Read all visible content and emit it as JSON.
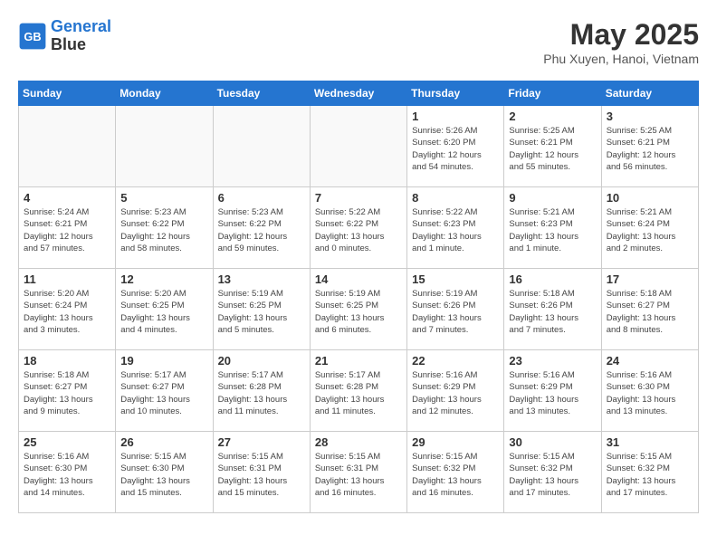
{
  "header": {
    "logo_line1": "General",
    "logo_line2": "Blue",
    "month": "May 2025",
    "location": "Phu Xuyen, Hanoi, Vietnam"
  },
  "weekdays": [
    "Sunday",
    "Monday",
    "Tuesday",
    "Wednesday",
    "Thursday",
    "Friday",
    "Saturday"
  ],
  "weeks": [
    [
      {
        "day": "",
        "info": ""
      },
      {
        "day": "",
        "info": ""
      },
      {
        "day": "",
        "info": ""
      },
      {
        "day": "",
        "info": ""
      },
      {
        "day": "1",
        "info": "Sunrise: 5:26 AM\nSunset: 6:20 PM\nDaylight: 12 hours\nand 54 minutes."
      },
      {
        "day": "2",
        "info": "Sunrise: 5:25 AM\nSunset: 6:21 PM\nDaylight: 12 hours\nand 55 minutes."
      },
      {
        "day": "3",
        "info": "Sunrise: 5:25 AM\nSunset: 6:21 PM\nDaylight: 12 hours\nand 56 minutes."
      }
    ],
    [
      {
        "day": "4",
        "info": "Sunrise: 5:24 AM\nSunset: 6:21 PM\nDaylight: 12 hours\nand 57 minutes."
      },
      {
        "day": "5",
        "info": "Sunrise: 5:23 AM\nSunset: 6:22 PM\nDaylight: 12 hours\nand 58 minutes."
      },
      {
        "day": "6",
        "info": "Sunrise: 5:23 AM\nSunset: 6:22 PM\nDaylight: 12 hours\nand 59 minutes."
      },
      {
        "day": "7",
        "info": "Sunrise: 5:22 AM\nSunset: 6:22 PM\nDaylight: 13 hours\nand 0 minutes."
      },
      {
        "day": "8",
        "info": "Sunrise: 5:22 AM\nSunset: 6:23 PM\nDaylight: 13 hours\nand 1 minute."
      },
      {
        "day": "9",
        "info": "Sunrise: 5:21 AM\nSunset: 6:23 PM\nDaylight: 13 hours\nand 1 minute."
      },
      {
        "day": "10",
        "info": "Sunrise: 5:21 AM\nSunset: 6:24 PM\nDaylight: 13 hours\nand 2 minutes."
      }
    ],
    [
      {
        "day": "11",
        "info": "Sunrise: 5:20 AM\nSunset: 6:24 PM\nDaylight: 13 hours\nand 3 minutes."
      },
      {
        "day": "12",
        "info": "Sunrise: 5:20 AM\nSunset: 6:25 PM\nDaylight: 13 hours\nand 4 minutes."
      },
      {
        "day": "13",
        "info": "Sunrise: 5:19 AM\nSunset: 6:25 PM\nDaylight: 13 hours\nand 5 minutes."
      },
      {
        "day": "14",
        "info": "Sunrise: 5:19 AM\nSunset: 6:25 PM\nDaylight: 13 hours\nand 6 minutes."
      },
      {
        "day": "15",
        "info": "Sunrise: 5:19 AM\nSunset: 6:26 PM\nDaylight: 13 hours\nand 7 minutes."
      },
      {
        "day": "16",
        "info": "Sunrise: 5:18 AM\nSunset: 6:26 PM\nDaylight: 13 hours\nand 7 minutes."
      },
      {
        "day": "17",
        "info": "Sunrise: 5:18 AM\nSunset: 6:27 PM\nDaylight: 13 hours\nand 8 minutes."
      }
    ],
    [
      {
        "day": "18",
        "info": "Sunrise: 5:18 AM\nSunset: 6:27 PM\nDaylight: 13 hours\nand 9 minutes."
      },
      {
        "day": "19",
        "info": "Sunrise: 5:17 AM\nSunset: 6:27 PM\nDaylight: 13 hours\nand 10 minutes."
      },
      {
        "day": "20",
        "info": "Sunrise: 5:17 AM\nSunset: 6:28 PM\nDaylight: 13 hours\nand 11 minutes."
      },
      {
        "day": "21",
        "info": "Sunrise: 5:17 AM\nSunset: 6:28 PM\nDaylight: 13 hours\nand 11 minutes."
      },
      {
        "day": "22",
        "info": "Sunrise: 5:16 AM\nSunset: 6:29 PM\nDaylight: 13 hours\nand 12 minutes."
      },
      {
        "day": "23",
        "info": "Sunrise: 5:16 AM\nSunset: 6:29 PM\nDaylight: 13 hours\nand 13 minutes."
      },
      {
        "day": "24",
        "info": "Sunrise: 5:16 AM\nSunset: 6:30 PM\nDaylight: 13 hours\nand 13 minutes."
      }
    ],
    [
      {
        "day": "25",
        "info": "Sunrise: 5:16 AM\nSunset: 6:30 PM\nDaylight: 13 hours\nand 14 minutes."
      },
      {
        "day": "26",
        "info": "Sunrise: 5:15 AM\nSunset: 6:30 PM\nDaylight: 13 hours\nand 15 minutes."
      },
      {
        "day": "27",
        "info": "Sunrise: 5:15 AM\nSunset: 6:31 PM\nDaylight: 13 hours\nand 15 minutes."
      },
      {
        "day": "28",
        "info": "Sunrise: 5:15 AM\nSunset: 6:31 PM\nDaylight: 13 hours\nand 16 minutes."
      },
      {
        "day": "29",
        "info": "Sunrise: 5:15 AM\nSunset: 6:32 PM\nDaylight: 13 hours\nand 16 minutes."
      },
      {
        "day": "30",
        "info": "Sunrise: 5:15 AM\nSunset: 6:32 PM\nDaylight: 13 hours\nand 17 minutes."
      },
      {
        "day": "31",
        "info": "Sunrise: 5:15 AM\nSunset: 6:32 PM\nDaylight: 13 hours\nand 17 minutes."
      }
    ]
  ]
}
